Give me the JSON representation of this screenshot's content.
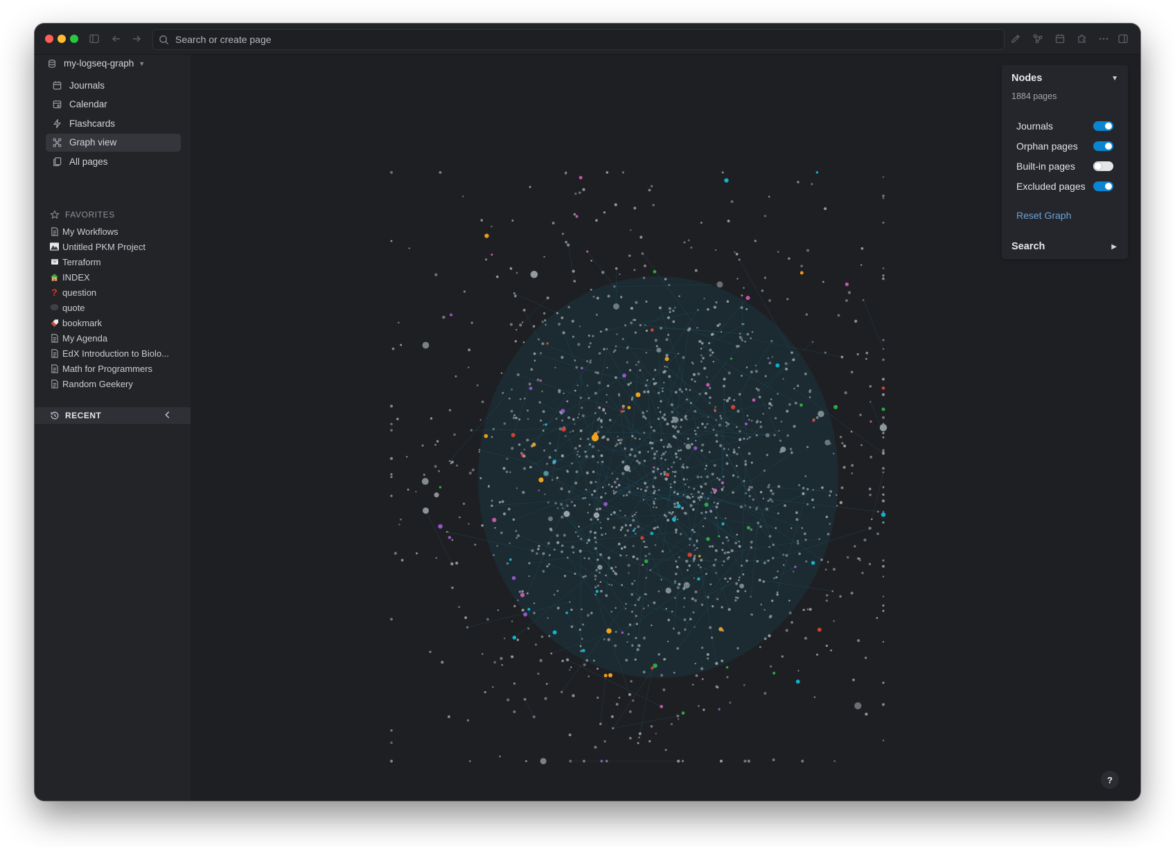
{
  "search": {
    "placeholder": "Search or create page"
  },
  "toolbar": {
    "icons": [
      "sidebar-toggle-icon",
      "back-arrow-icon",
      "forward-arrow-icon",
      "pencil-icon",
      "graph-icon",
      "calendar-icon",
      "puzzle-icon",
      "more-icon",
      "right-sidebar-icon"
    ]
  },
  "sidebar": {
    "graph_name": "my-logseq-graph",
    "nav": [
      {
        "label": "Journals",
        "icon": "calendar-icon"
      },
      {
        "label": "Calendar",
        "icon": "calendar-icon"
      },
      {
        "label": "Flashcards",
        "icon": "bolt-icon"
      },
      {
        "label": "Graph view",
        "icon": "graph-icon",
        "active": true
      },
      {
        "label": "All pages",
        "icon": "pages-icon"
      }
    ],
    "favorites_title": "FAVORITES",
    "favorites": [
      {
        "label": "My Workflows",
        "icon": "page-icon"
      },
      {
        "label": "Untitled PKM Project",
        "icon": "mountain-icon"
      },
      {
        "label": "Terraform",
        "icon": "box-icon"
      },
      {
        "label": "INDEX",
        "icon": "house-icon"
      },
      {
        "label": "question",
        "icon": "question-mark-icon"
      },
      {
        "label": "quote",
        "icon": "speech-bubble-icon"
      },
      {
        "label": "bookmark",
        "icon": "bookmark-icon"
      },
      {
        "label": "My Agenda",
        "icon": "page-icon"
      },
      {
        "label": "EdX Introduction to Biolo...",
        "icon": "page-icon"
      },
      {
        "label": "Math for Programmers",
        "icon": "page-icon"
      },
      {
        "label": "Random Geekery",
        "icon": "page-icon"
      }
    ],
    "recent_title": "RECENT"
  },
  "graph_panel": {
    "title": "Nodes",
    "count": "1884 pages",
    "toggles": [
      {
        "label": "Journals",
        "on": true
      },
      {
        "label": "Orphan pages",
        "on": true
      },
      {
        "label": "Built-in pages",
        "on": false
      },
      {
        "label": "Excluded pages",
        "on": true
      }
    ],
    "reset_label": "Reset Graph",
    "search_label": "Search"
  },
  "help": {
    "label": "?"
  },
  "colors": {
    "accent": "#0b85d0",
    "node_default": "#9aa4a8",
    "node_orange": "#f3a21c",
    "node_cyan": "#12b8d4",
    "node_purple": "#9b59d0",
    "node_red": "#d64533",
    "node_green": "#2fae4a",
    "node_pink": "#d15bb5",
    "link": "#1c6f86"
  }
}
